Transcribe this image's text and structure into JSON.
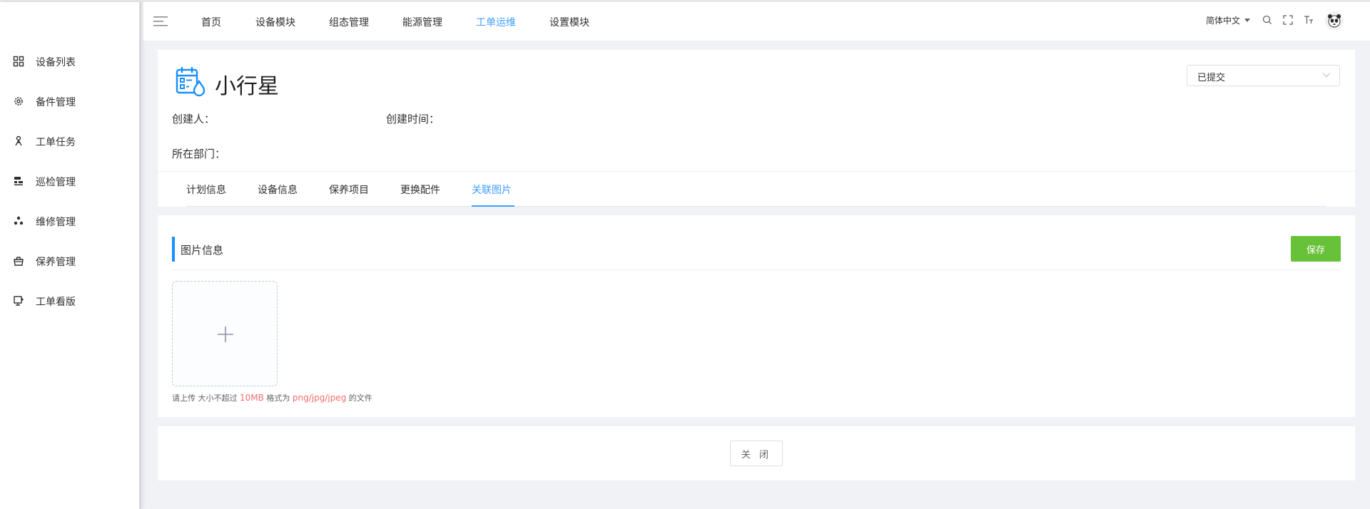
{
  "sidebar": {
    "items": [
      {
        "label": "设备列表",
        "icon": "grid-icon"
      },
      {
        "label": "备件管理",
        "icon": "gear-icon"
      },
      {
        "label": "工单任务",
        "icon": "person-icon"
      },
      {
        "label": "巡检管理",
        "icon": "sitemap-icon"
      },
      {
        "label": "维修管理",
        "icon": "cluster-icon"
      },
      {
        "label": "保养管理",
        "icon": "toolbox-icon"
      },
      {
        "label": "工单看版",
        "icon": "monitor-icon"
      }
    ]
  },
  "navbar": {
    "items": [
      "首页",
      "设备模块",
      "组态管理",
      "能源管理",
      "工单运维",
      "设置模块"
    ],
    "active": "工单运维",
    "language": "简体中文"
  },
  "header": {
    "title": "小行星",
    "creator_label": "创建人：",
    "created_time_label": "创建时间：",
    "department_label": "所在部门：",
    "status_value": "已提交"
  },
  "tabs": {
    "items": [
      "计划信息",
      "设备信息",
      "保养项目",
      "更换配件",
      "关联图片"
    ],
    "active": "关联图片"
  },
  "images_section": {
    "title": "图片信息",
    "save_label": "保存",
    "tip_prefix": "请上传 大小不超过 ",
    "tip_size": "10MB",
    "tip_middle": " 格式为 ",
    "tip_formats": "png/jpg/jpeg",
    "tip_suffix": " 的文件"
  },
  "footer": {
    "close_label": "关 闭"
  },
  "colors": {
    "accent": "#409eff",
    "save_green": "#67c23a",
    "highlight_red": "#f56c6c",
    "section_bar": "#1890ff"
  }
}
